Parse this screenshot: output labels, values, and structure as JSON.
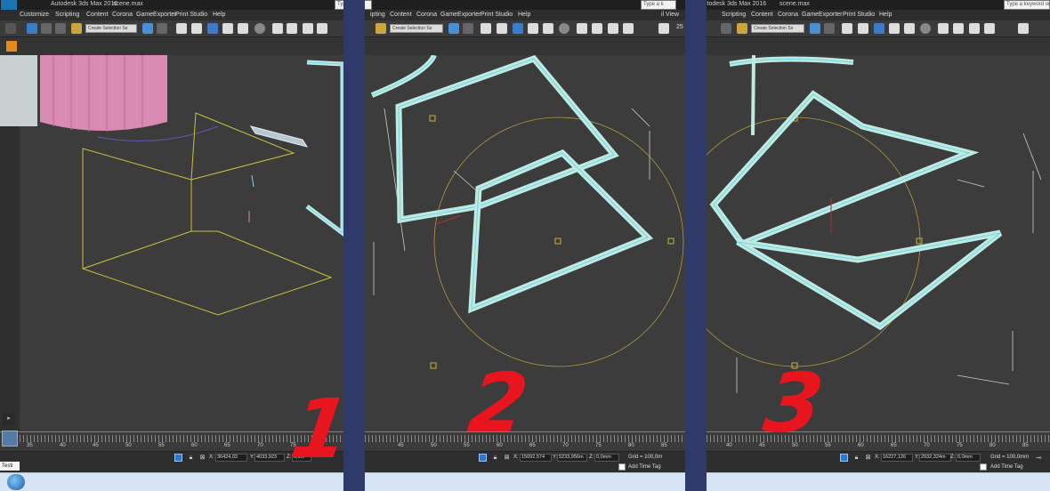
{
  "app": {
    "title": "Autodesk 3ds Max 2016",
    "file": "scene.max",
    "logo": "MAX"
  },
  "menu": {
    "items": [
      "Customize",
      "Scripting",
      "Content",
      "Corona",
      "GameExporter",
      "Print Studio",
      "Help"
    ],
    "items_cut": [
      "ipting",
      "Content",
      "Corona",
      "GameExporter",
      "Print Studio",
      "Help"
    ]
  },
  "search": {
    "left_text": "Type a",
    "mid_text": "Type a k",
    "right_text": "Type a keyword or phr"
  },
  "toolbar": {
    "selection_set": "Create Selection Se",
    "right_label_2": "25",
    "view_label": "il View"
  },
  "timeline": {
    "ticks_panel1": [
      "35",
      "40",
      "45",
      "50",
      "55",
      "60",
      "65",
      "70",
      "75"
    ],
    "ticks_panel2": [
      "45",
      "50",
      "55",
      "60",
      "65",
      "70",
      "75",
      "80",
      "85"
    ],
    "ticks_panel3": [
      "40",
      "45",
      "50",
      "55",
      "60",
      "65",
      "70",
      "75",
      "80",
      "85"
    ]
  },
  "status": {
    "panel1": {
      "x_label": "X:",
      "x": "36424,03",
      "y_label": "Y:",
      "y": "4033,923",
      "z_label": "Z:",
      "z": "0,0m"
    },
    "panel2": {
      "x_label": "X:",
      "x": "15092,574",
      "y_label": "Y:",
      "y": "5233,956m",
      "z_label": "Z:",
      "z": "0,0mm",
      "grid": "Grid = 100,0m",
      "time_tag": "Add Time Tag"
    },
    "panel3": {
      "x_label": "X:",
      "x": "16227,126",
      "y_label": "Y:",
      "y": "2932,324m",
      "z_label": "Z:",
      "z": "0,0mm",
      "grid": "Grid = 100,0mm",
      "time_tag": "Add Time Tag"
    },
    "testi": "Testi"
  },
  "annotations": {
    "labels": [
      "1",
      "2",
      "3"
    ],
    "color": "#e8141e"
  },
  "colors": {
    "divider": "#2e3a6a",
    "selection_frame": "#bfeae0",
    "selection_outline": "#6fd4ee",
    "helper_yellow": "#c9c23a",
    "gizmo_orange": "#b09a3a",
    "pink_object": "#d98bb3"
  }
}
